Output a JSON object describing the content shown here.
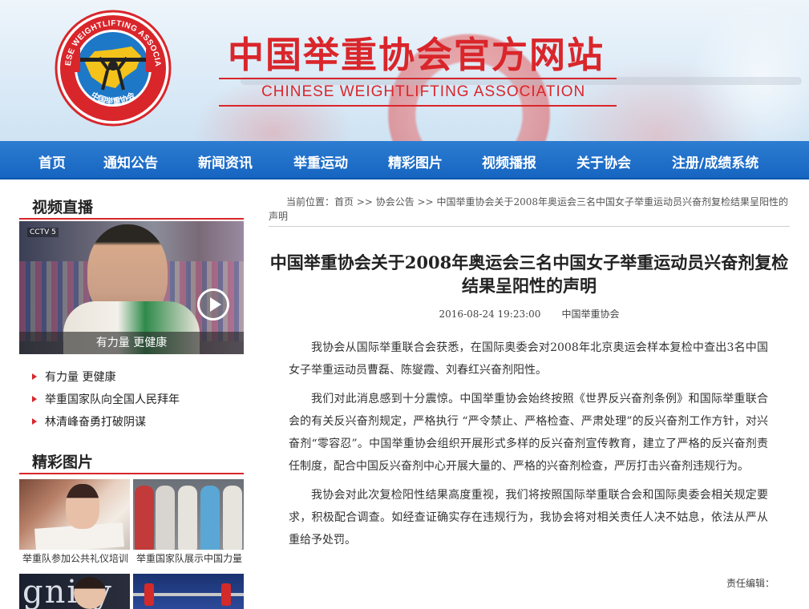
{
  "header": {
    "title_cn": "中国举重协会官方网站",
    "title_en": "CHINESE WEIGHTLIFTING ASSOCIATION",
    "logo_text_en": "CHINESE WEIGHTLIFTING ASSOCIATION",
    "logo_text_cn": "中国举重协会"
  },
  "nav": {
    "items": [
      "首页",
      "通知公告",
      "新闻资讯",
      "举重运动",
      "精彩图片",
      "视频播报",
      "关于协会",
      "注册/成绩系统"
    ]
  },
  "sidebar": {
    "video_section_title": "视频直播",
    "video_caption": "有力量 更健康",
    "video_channel": "CCTV 5",
    "video_list": [
      "有力量 更健康",
      "举重国家队向全国人民拜年",
      "林清峰奋勇打破阴谋"
    ],
    "gallery_section_title": "精彩图片",
    "gallery": [
      {
        "caption": "举重队参加公共礼仪培训"
      },
      {
        "caption": "举重国家队展示中国力量"
      }
    ],
    "gallery_more_text": "gnity"
  },
  "breadcrumb": {
    "text": "当前位置：首页 >> 协会公告 >> 中国举重协会关于2008年奥运会三名中国女子举重运动员兴奋剂复检结果呈阳性的声明"
  },
  "article": {
    "title": "中国举重协会关于2008年奥运会三名中国女子举重运动员兴奋剂复检结果呈阳性的声明",
    "date": "2016-08-24 19:23:00",
    "source": "中国举重协会",
    "paragraphs": [
      "我协会从国际举重联合会获悉，在国际奥委会对2008年北京奥运会样本复检中查出3名中国女子举重运动员曹磊、陈燮霞、刘春红兴奋剂阳性。",
      "我们对此消息感到十分震惊。中国举重协会始终按照《世界反兴奋剂条例》和国际举重联合会的有关反兴奋剂规定，严格执行 “严令禁止、严格检查、严肃处理”的反兴奋剂工作方针，对兴奋剂“零容忍”。中国举重协会组织开展形式多样的反兴奋剂宣传教育，建立了严格的反兴奋剂责任制度，配合中国反兴奋剂中心开展大量的、严格的兴奋剂检查，严厉打击兴奋剂违规行为。",
      "我协会对此次复检阳性结果高度重视，我们将按照国际举重联合会和国际奥委会相关规定要求，积极配合调查。如经查证确实存在违规行为，我协会将对相关责任人决不姑息，依法从严从重给予处罚。"
    ],
    "editor_label": "责任编辑："
  },
  "colors": {
    "brand_red": "#d9262b",
    "nav_blue": "#1665c1"
  }
}
